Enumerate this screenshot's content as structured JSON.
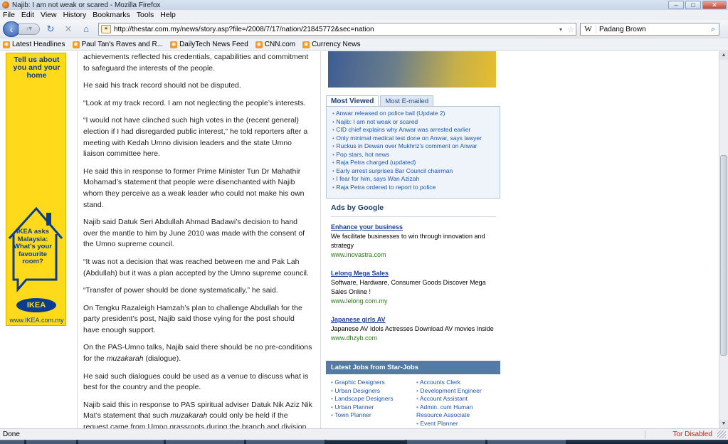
{
  "window": {
    "title": "Najib: I am not weak or scared - Mozilla Firefox"
  },
  "menu": [
    "File",
    "Edit",
    "View",
    "History",
    "Bookmarks",
    "Tools",
    "Help"
  ],
  "nav": {
    "url": "http://thestar.com.my/news/story.asp?file=/2008/7/17/nation/21845772&sec=nation",
    "search_engine": "W",
    "search_value": "Padang Brown"
  },
  "bookmarks": [
    "Latest Headlines",
    "Paul Tan's Raves and R...",
    "DailyTech News Feed",
    "CNN.com",
    "Currency News"
  ],
  "ikea_ad": {
    "headline": "Tell us about you and your home",
    "question": "IKEA asks Malaysia: What's your favourite room?",
    "logo": "IKEA",
    "site": "www.IKEA.com.my"
  },
  "article": {
    "paragraphs": [
      "achievements reflected his credentials, capabilities and commitment to safeguard the interests of the people.",
      "He said his track record should not be disputed.",
      "“Look at my track record. I am not neglecting the people’s interests.",
      "“I would not have clinched such high votes in the (recent general) election if I had disregarded public interest,” he told reporters after a meeting with Kedah Umno division leaders and the state Umno liaison committee here.",
      "He said this in response to former Prime Minister Tun Dr Mahathir Mohamad’s statement that people were disenchanted with Najib whom they perceive as a weak leader who could not make his own stand.",
      "Najib said Datuk Seri Abdullah Ahmad Badawi’s decision to hand over the mantle to him by June 2010 was made with the consent of the Umno supreme council.",
      "“It was not a decision that was reached between me and Pak Lah (Abdullah) but it was a plan accepted by the Umno supreme council.",
      "“Transfer of power should be done systematically,” he said.",
      "On Tengku Razaleigh Hamzah’s plan to challenge Abdullah for the party president’s post, Najib said those vying for the post should have enough support."
    ],
    "p10_before": "On the PAS-Umno talks, Najib said there should be no pre-conditions for the ",
    "p10_em": "muzakarah",
    "p10_after": " (dialogue).",
    "p11": "He said such dialogues could be used as a venue to discuss what is best for the country and the people.",
    "p12_before": "Najib said this in response to PAS spiritual adviser Datuk Nik Aziz Nik Mat’s statement that such ",
    "p12_em": "muzakarah",
    "p12_after": " could only be held if the request came from Umno grassroots during the branch and division AGMs."
  },
  "most_viewed": {
    "tab_active": "Most Viewed",
    "tab_other": "Most E-mailed",
    "items": [
      "Anwar released on police bail (Update 2)",
      "Najib: I am not weak or scared",
      "CID chief explains why Anwar was arrested earlier",
      "Only minimal medical test done on Anwar, says lawyer",
      "Ruckus in Dewan over Mukhriz's comment on Anwar",
      "Pop stars, hot news",
      "Raja Petra charged (updated)",
      "Early arrest surprises Bar Council chairman",
      "I fear for him, says Wan Azizah",
      "Raja Petra ordered to report to police"
    ]
  },
  "ads": {
    "title": "Ads by Google",
    "items": [
      {
        "link": "Enhance your business",
        "desc": "We facilitate businesses to win through innovation and strategy",
        "url": "www.inovastra.com"
      },
      {
        "link": "Lelong Mega Sales",
        "desc": "Software, Hardware, Consumer Goods Discover Mega Sales Online !",
        "url": "www.lelong.com.my"
      },
      {
        "link": "Japanese girls AV",
        "desc": "Japanese AV Idols Actresses Download AV movies Inside",
        "url": "www.dhzyb.com"
      }
    ]
  },
  "jobs": {
    "title": "Latest Jobs from Star-Jobs",
    "left": [
      "Graphic Designers",
      "Urban Designers",
      "Landscape Designers",
      "Urban Planner",
      "Town Planner"
    ],
    "right": [
      "Accounts Clerk",
      "Development Engineer",
      "Account Assistant",
      "Admin. cum Human Resource Associate",
      "Event Planner"
    ]
  },
  "status": {
    "left": "Done",
    "right": "Tor Disabled"
  }
}
